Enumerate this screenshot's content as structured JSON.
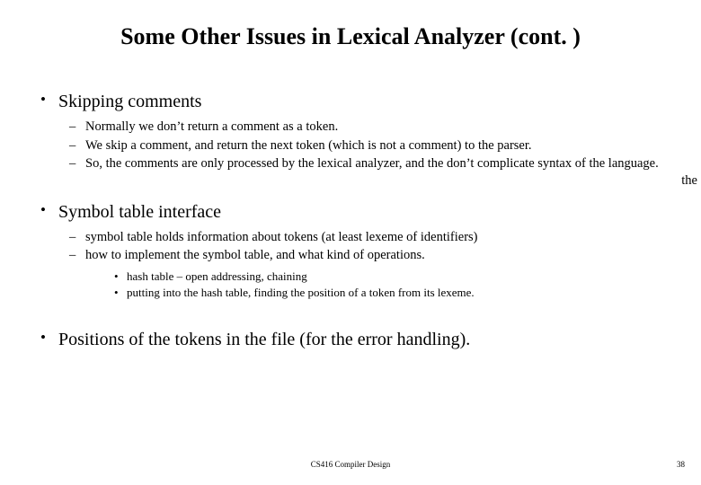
{
  "title": "Some Other Issues in Lexical Analyzer (cont. )",
  "sections": [
    {
      "heading": "Skipping comments",
      "subs": [
        "Normally we don’t return a comment as a token.",
        "We skip a comment, and return the next token (which is not a comment) to the parser.",
        "So, the comments are only processed by the lexical analyzer, and the don’t complicate syntax of the language."
      ],
      "trail": "the"
    },
    {
      "heading": "Symbol table interface",
      "subs": [
        "symbol table holds information about tokens (at least lexeme of identifiers)",
        "how to implement the symbol table, and what kind of operations."
      ],
      "subsubs": [
        "hash table – open addressing, chaining",
        "putting into the hash table, finding the position of a token from its lexeme."
      ]
    },
    {
      "heading": "Positions of  the tokens in the file (for the error handling).",
      "subs": []
    }
  ],
  "footer": {
    "center": "CS416 Compiler Design",
    "page": "38"
  },
  "glyphs": {
    "bullet": "•",
    "dash": "–"
  }
}
